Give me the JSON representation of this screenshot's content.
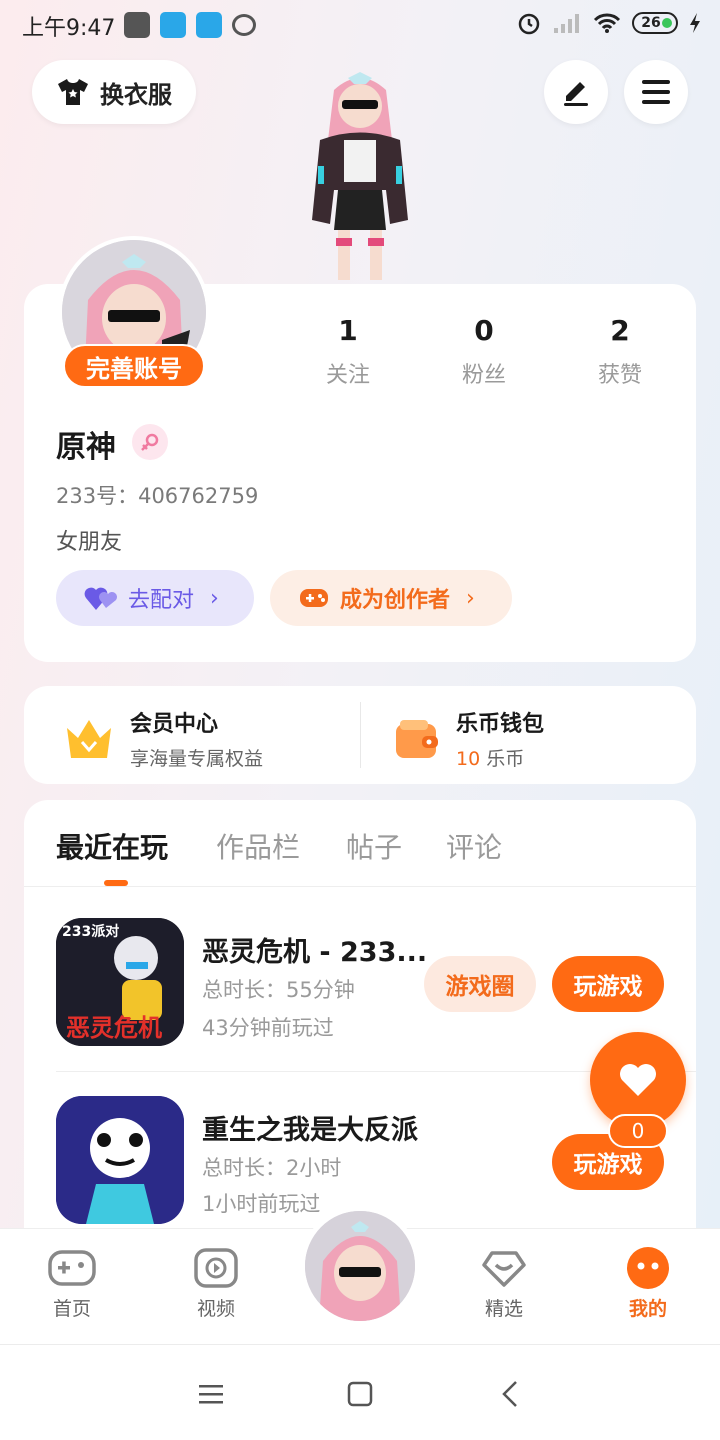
{
  "status_bar": {
    "time": "上午9:47",
    "battery": "26"
  },
  "header": {
    "change_outfit_label": "换衣服"
  },
  "profile": {
    "complete_account_label": "完善账号",
    "stats": [
      {
        "value": "1",
        "label": "关注"
      },
      {
        "value": "0",
        "label": "粉丝"
      },
      {
        "value": "2",
        "label": "获赞"
      }
    ],
    "name": "原神",
    "uid": "233号：406762759",
    "bio": "女朋友",
    "pair_button": "去配对",
    "creator_button": "成为创作者"
  },
  "vip": {
    "member_title": "会员中心",
    "member_sub": "享海量专属权益",
    "wallet_title": "乐币钱包",
    "wallet_amount": "10",
    "wallet_unit": "乐币"
  },
  "tabs": [
    "最近在玩",
    "作品栏",
    "帖子",
    "评论"
  ],
  "games": [
    {
      "title": "恶灵危机 - 233...",
      "duration": "总时长：55分钟",
      "last_played": "43分钟前玩过",
      "circle_button": "游戏圈",
      "play_button": "玩游戏",
      "icon_badge": "233派对",
      "icon_text": "恶灵危机"
    },
    {
      "title": "重生之我是大反派",
      "duration": "总时长：2小时",
      "last_played": "1小时前玩过",
      "play_button": "玩游戏"
    }
  ],
  "fab": {
    "count": "0"
  },
  "bottom_nav": [
    {
      "label": "首页",
      "icon": "gamepad-icon"
    },
    {
      "label": "视频",
      "icon": "video-play-icon"
    },
    {
      "label": "精选",
      "icon": "heart-diamond-icon"
    },
    {
      "label": "我的",
      "icon": "smiley-face-icon"
    }
  ],
  "colors": {
    "accent": "#ff6a13",
    "pair_purple": "#6a5ae6"
  }
}
